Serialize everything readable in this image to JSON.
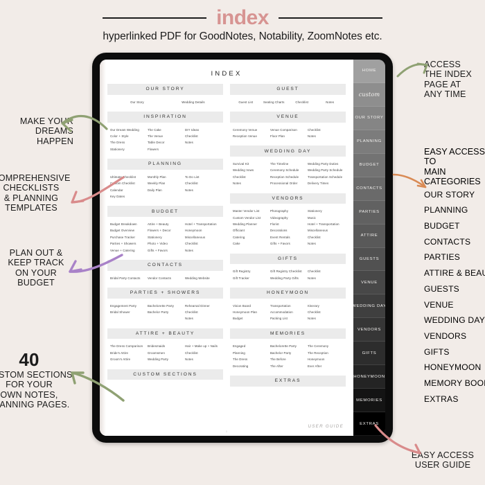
{
  "header": {
    "title": "index",
    "subtitle": "hyperlinked PDF for GoodNotes, Notability, ZoomNotes etc."
  },
  "colors": {
    "background": "#f2ece8",
    "title_pink": "#d79492",
    "arrow_green": "#8fa173",
    "arrow_pink": "#d98b8b",
    "arrow_purple": "#a982c8",
    "arrow_orange": "#d98a54",
    "tab_dark": "#2f2f2f",
    "section_head_bg": "#ebebeb"
  },
  "index_page": {
    "heading": "INDEX",
    "user_guide_label": "USER GUIDE",
    "page_number": "1",
    "left_column": [
      {
        "title": "OUR STORY",
        "layout": "center-4",
        "columns": [
          [
            "Our Story"
          ],
          [
            "Wedding Details"
          ]
        ]
      },
      {
        "title": "INSPIRATION",
        "layout": "left-3",
        "columns": [
          [
            "Our Dream Wedding",
            "Color + Style",
            "The Dress",
            "Stationery"
          ],
          [
            "The Cake",
            "The Venue",
            "Table Decor",
            "Flowers"
          ],
          [
            "DIY Ideas",
            "Checklist",
            "Notes"
          ]
        ]
      },
      {
        "title": "PLANNING",
        "layout": "left-3",
        "columns": [
          [
            "Ultimate Checklist",
            "Custom Checklist",
            "Calendar",
            "Key Dates"
          ],
          [
            "Monthly Plan",
            "Weekly Plan",
            "Daily Plan"
          ],
          [
            "To Do List",
            "Checklist",
            "Notes"
          ]
        ]
      },
      {
        "title": "BUDGET",
        "layout": "left-3",
        "columns": [
          [
            "Budget Breakdown",
            "Budget Overview",
            "Purchase Tracker",
            "Parties + Showers",
            "Venue + Catering"
          ],
          [
            "Attire + Beauty",
            "Flowers + Decor",
            "Stationery",
            "Photo + Video",
            "Gifts + Favors"
          ],
          [
            "Hotel + Transportation",
            "Honeymoon",
            "Miscellaneous",
            "Checklist",
            "Notes"
          ]
        ]
      },
      {
        "title": "CONTACTS",
        "layout": "left-3",
        "columns": [
          [
            "Bridal Party Contacts"
          ],
          [
            "Vendor Contacts"
          ],
          [
            "Wedding Website"
          ]
        ]
      },
      {
        "title": "PARTIES + SHOWERS",
        "layout": "left-3",
        "columns": [
          [
            "Engagement Party",
            "Bridal Shower"
          ],
          [
            "Bachelorette Party",
            "Bachelor Party"
          ],
          [
            "Rehearsal Dinner",
            "Checklist",
            "Notes"
          ]
        ]
      },
      {
        "title": "ATTIRE + BEAUTY",
        "layout": "left-3",
        "columns": [
          [
            "The Dress Comparison",
            "Bride's Attire",
            "Groom's Attire"
          ],
          [
            "Bridesmaids",
            "Groomsmen",
            "Wedding Party"
          ],
          [
            "Hair + Make up + Nails",
            "Checklist",
            "Notes"
          ]
        ]
      },
      {
        "title": "CUSTOM SECTIONS",
        "layout": "empty",
        "columns": []
      }
    ],
    "right_column": [
      {
        "title": "GUEST",
        "layout": "center-4",
        "columns": [
          [
            "Guest List"
          ],
          [
            "Seating Charts"
          ],
          [
            "Checklist"
          ],
          [
            "Notes"
          ]
        ]
      },
      {
        "title": "VENUE",
        "layout": "left-3",
        "columns": [
          [
            "Ceremony Venue",
            "Reception Venue"
          ],
          [
            "Venue Comparison",
            "Floor Plan"
          ],
          [
            "Checklist",
            "Notes"
          ]
        ]
      },
      {
        "title": "WEDDING DAY",
        "layout": "left-3",
        "columns": [
          [
            "Survival Kit",
            "Wedding Vows",
            "Checklist",
            "Notes"
          ],
          [
            "The Timeline",
            "Ceremony Schedule",
            "Reception Schedule",
            "Processional Order"
          ],
          [
            "Wedding Party Duties",
            "Wedding Party Schedule",
            "Transportation Schedule",
            "Delivery Times"
          ]
        ]
      },
      {
        "title": "VENDORS",
        "layout": "left-3",
        "columns": [
          [
            "Master Vendor List",
            "Custom Vendor List",
            "Wedding Planner",
            "Officiant",
            "Catering",
            "Cake"
          ],
          [
            "Photography",
            "Videography",
            "Florist",
            "Decorations",
            "Event Rentals",
            "Gifts + Favors"
          ],
          [
            "Stationery",
            "Music",
            "Hotel + Transportation",
            "Miscellaneous",
            "Checklist",
            "Notes"
          ]
        ]
      },
      {
        "title": "GIFTS",
        "layout": "left-3",
        "columns": [
          [
            "Gift Registry",
            "Gift Tracker"
          ],
          [
            "Gift Registry Checklist",
            "Wedding Party Gifts"
          ],
          [
            "Checklist",
            "Notes"
          ]
        ]
      },
      {
        "title": "HONEYMOON",
        "layout": "left-3",
        "columns": [
          [
            "Vision Board",
            "Honeymoon Plan",
            "Budget"
          ],
          [
            "Transportation",
            "Accommodation",
            "Packing List"
          ],
          [
            "Itinerary",
            "Checklist",
            "Notes"
          ]
        ]
      },
      {
        "title": "MEMORIES",
        "layout": "left-3",
        "columns": [
          [
            "Engaged",
            "Planning",
            "The Dress",
            "Decorating"
          ],
          [
            "Bachelorette Party",
            "Bachelor Party",
            "The Before",
            "The After"
          ],
          [
            "The Ceremony",
            "The Reception",
            "Honeymoon",
            "Ever After"
          ]
        ]
      },
      {
        "title": "EXTRAS",
        "layout": "empty",
        "columns": []
      }
    ]
  },
  "side_tabs": [
    {
      "label": "HOME",
      "style": "plain",
      "bg": "#a0a0a0"
    },
    {
      "label": "custom",
      "style": "script",
      "bg": "#8e8e8e"
    },
    {
      "label": "OUR STORY",
      "style": "plain",
      "bg": "#858585"
    },
    {
      "label": "PLANNING",
      "style": "plain",
      "bg": "#7c7c7c"
    },
    {
      "label": "BUDGET",
      "style": "plain",
      "bg": "#737373"
    },
    {
      "label": "CONTACTS",
      "style": "plain",
      "bg": "#6a6a6a"
    },
    {
      "label": "PARTIES",
      "style": "plain",
      "bg": "#616161"
    },
    {
      "label": "ATTIRE",
      "style": "plain",
      "bg": "#595959"
    },
    {
      "label": "GUESTS",
      "style": "plain",
      "bg": "#515151"
    },
    {
      "label": "VENUE",
      "style": "plain",
      "bg": "#484848"
    },
    {
      "label": "WEDDING DAY",
      "style": "plain",
      "bg": "#3f3f3f"
    },
    {
      "label": "VENDORS",
      "style": "plain",
      "bg": "#363636"
    },
    {
      "label": "GIFTS",
      "style": "plain",
      "bg": "#2d2d2d"
    },
    {
      "label": "HONEYMOON",
      "style": "plain",
      "bg": "#242424"
    },
    {
      "label": "MEMORIES",
      "style": "plain",
      "bg": "#141414"
    },
    {
      "label": "EXTRAS",
      "style": "plain",
      "bg": "#000000"
    }
  ],
  "annotations": {
    "dreams": "MAKE YOUR\nDREAMS HAPPEN",
    "checklists": "COMPREHENSIVE\nCHECKLISTS\n& PLANNING\nTEMPLATES",
    "budget": "PLAN OUT &\nKEEP TRACK\nON YOUR\nBUDGET",
    "custom_number": "40",
    "custom_text": "CUSTOM SECTIONS\nFOR YOUR\nOWN NOTES,\nPLANNING PAGES.",
    "access": "ACCESS\nTHE INDEX\nPAGE AT\nANY TIME",
    "user_guide": "EASY ACCESS\nUSER GUIDE",
    "categories_head": "EASY ACCESS TO\nMAIN CATEGORIES",
    "categories": [
      "OUR STORY",
      "PLANNING",
      "BUDGET",
      "CONTACTS",
      "PARTIES",
      "ATTIRE & BEAUTY",
      "GUESTS",
      "VENUE",
      "WEDDING DAY",
      "VENDORS",
      "GIFTS",
      "HONEYMOON",
      "MEMORY BOOK",
      "EXTRAS"
    ]
  }
}
